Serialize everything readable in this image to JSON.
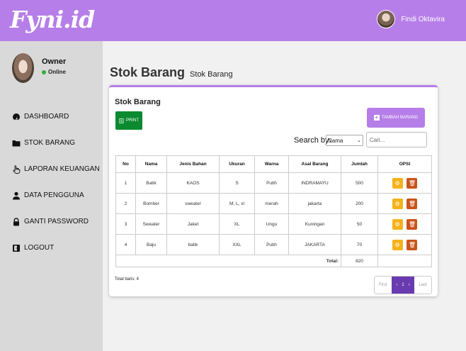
{
  "brand": "Fyni.id",
  "top_user": "Findi Oktavira",
  "profile": {
    "name": "Owner",
    "status": "Online"
  },
  "menu": [
    {
      "label": "DASHBOARD",
      "icon": "dashboard-icon"
    },
    {
      "label": "STOK BARANG",
      "icon": "folder-icon"
    },
    {
      "label": "LAPORAN KEUANGAN",
      "icon": "hand-pointer-icon"
    },
    {
      "label": "DATA PENGGUNA",
      "icon": "user-icon"
    },
    {
      "label": "GANTI PASSWORD",
      "icon": "lock-icon"
    },
    {
      "label": "LOGOUT",
      "icon": "logout-icon"
    }
  ],
  "page": {
    "title": "Stok Barang",
    "subtitle": "Stok Barang"
  },
  "card": {
    "title": "Stok Barang",
    "print_label": "PRINT",
    "tambah_label": "TAMBAH BARANG",
    "search_label": "Search by:",
    "search_select": "Nama",
    "search_placeholder": "Cari..."
  },
  "table": {
    "headers": [
      "No",
      "Nama",
      "Jenis Bahan",
      "Ukuran",
      "Warna",
      "Asal Barang",
      "Jumlah",
      "OPSI"
    ],
    "rows": [
      [
        "1",
        "Batik",
        "KAOS",
        "S",
        "Putih",
        "INDRAMAYU",
        "500"
      ],
      [
        "2",
        "Bomber",
        "sweater",
        "M, L, xl",
        "merah",
        "jakarta",
        "200"
      ],
      [
        "3",
        "Sweater",
        "Jaket",
        "XL",
        "Ungu",
        "Kuningan",
        "50"
      ],
      [
        "4",
        "Baju",
        "batik",
        "XXL",
        "Putih",
        "JAKARTA",
        "70"
      ]
    ],
    "total_label": "Total:",
    "total_value": "820"
  },
  "footer": {
    "total_baris": "Total baris: 4",
    "pager_first": "First",
    "pager_prev": "‹",
    "pager_current": "1",
    "pager_next": "›",
    "pager_last": "Last"
  },
  "colors": {
    "accent": "#b67ee8",
    "print": "#0b8a2f",
    "edit": "#f5b21c",
    "delete": "#c9541a",
    "pager_active": "#6a3bb0"
  }
}
